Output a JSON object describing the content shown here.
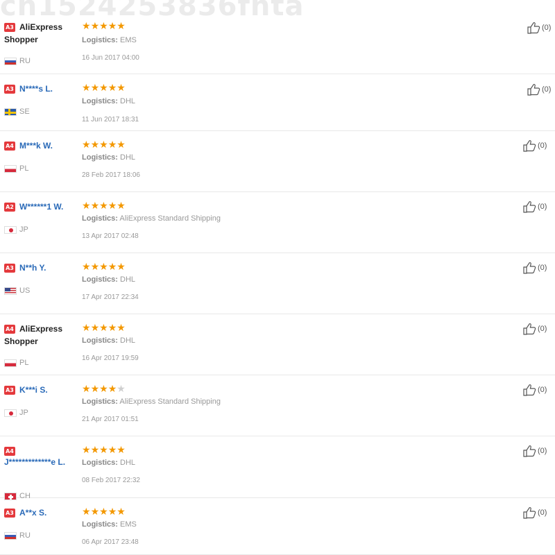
{
  "watermark": "cn1524253836fhta",
  "logistics_label": "Logistics:",
  "reviews": [
    {
      "level": "A3",
      "name": "AliExpress Shopper",
      "name_style": "dark",
      "country": "RU",
      "flag": "ru",
      "stars": 5,
      "logistics": "EMS",
      "date": "16 Jun 2017 04:00",
      "helpful": "(0)"
    },
    {
      "level": "A3",
      "name": "N****s L.",
      "name_style": "link",
      "country": "SE",
      "flag": "se",
      "stars": 5,
      "logistics": "DHL",
      "date": "11 Jun 2017 18:31",
      "helpful": "(0)"
    },
    {
      "level": "A4",
      "name": "M***k W.",
      "name_style": "link",
      "country": "PL",
      "flag": "pl",
      "stars": 5,
      "logistics": "DHL",
      "date": "28 Feb 2017 18:06",
      "helpful": "(0)"
    },
    {
      "level": "A2",
      "name": "W******1 W.",
      "name_style": "link",
      "country": "JP",
      "flag": "jp",
      "stars": 5,
      "logistics": "AliExpress Standard Shipping",
      "date": "13 Apr 2017 02:48",
      "helpful": "(0)"
    },
    {
      "level": "A3",
      "name": "N**h Y.",
      "name_style": "link",
      "country": "US",
      "flag": "us",
      "stars": 5,
      "logistics": "DHL",
      "date": "17 Apr 2017 22:34",
      "helpful": "(0)"
    },
    {
      "level": "A4",
      "name": "AliExpress Shopper",
      "name_style": "dark",
      "country": "PL",
      "flag": "pl",
      "stars": 5,
      "logistics": "DHL",
      "date": "16 Apr 2017 19:59",
      "helpful": "(0)"
    },
    {
      "level": "A3",
      "name": "K***i S.",
      "name_style": "link",
      "country": "JP",
      "flag": "jp",
      "stars": 4,
      "logistics": "AliExpress Standard Shipping",
      "date": "21 Apr 2017 01:51",
      "helpful": "(0)"
    },
    {
      "level": "A4",
      "name": "J*************e L.",
      "name_style": "wrap",
      "country": "CH",
      "flag": "ch",
      "stars": 5,
      "logistics": "DHL",
      "date": "08 Feb 2017 22:32",
      "helpful": "(0)"
    },
    {
      "level": "A3",
      "name": "A**x S.",
      "name_style": "link",
      "country": "RU",
      "flag": "ru",
      "stars": 5,
      "logistics": "EMS",
      "date": "06 Apr 2017 23:48",
      "helpful": "(0)"
    }
  ]
}
